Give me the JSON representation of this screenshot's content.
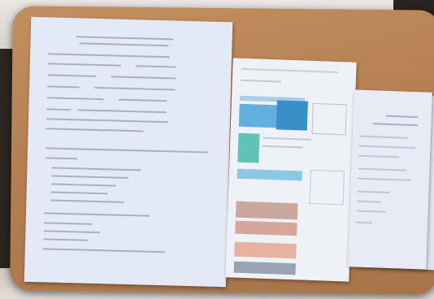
{
  "scene": {
    "description_colors": {
      "board": "#b9844f",
      "paper": "#e8ecf6",
      "table_blue": "#4aa3d8",
      "table_teal": "#5fc3b6",
      "table_pink": "#e6b7a6",
      "table_gray": "#9aa3b2"
    }
  }
}
